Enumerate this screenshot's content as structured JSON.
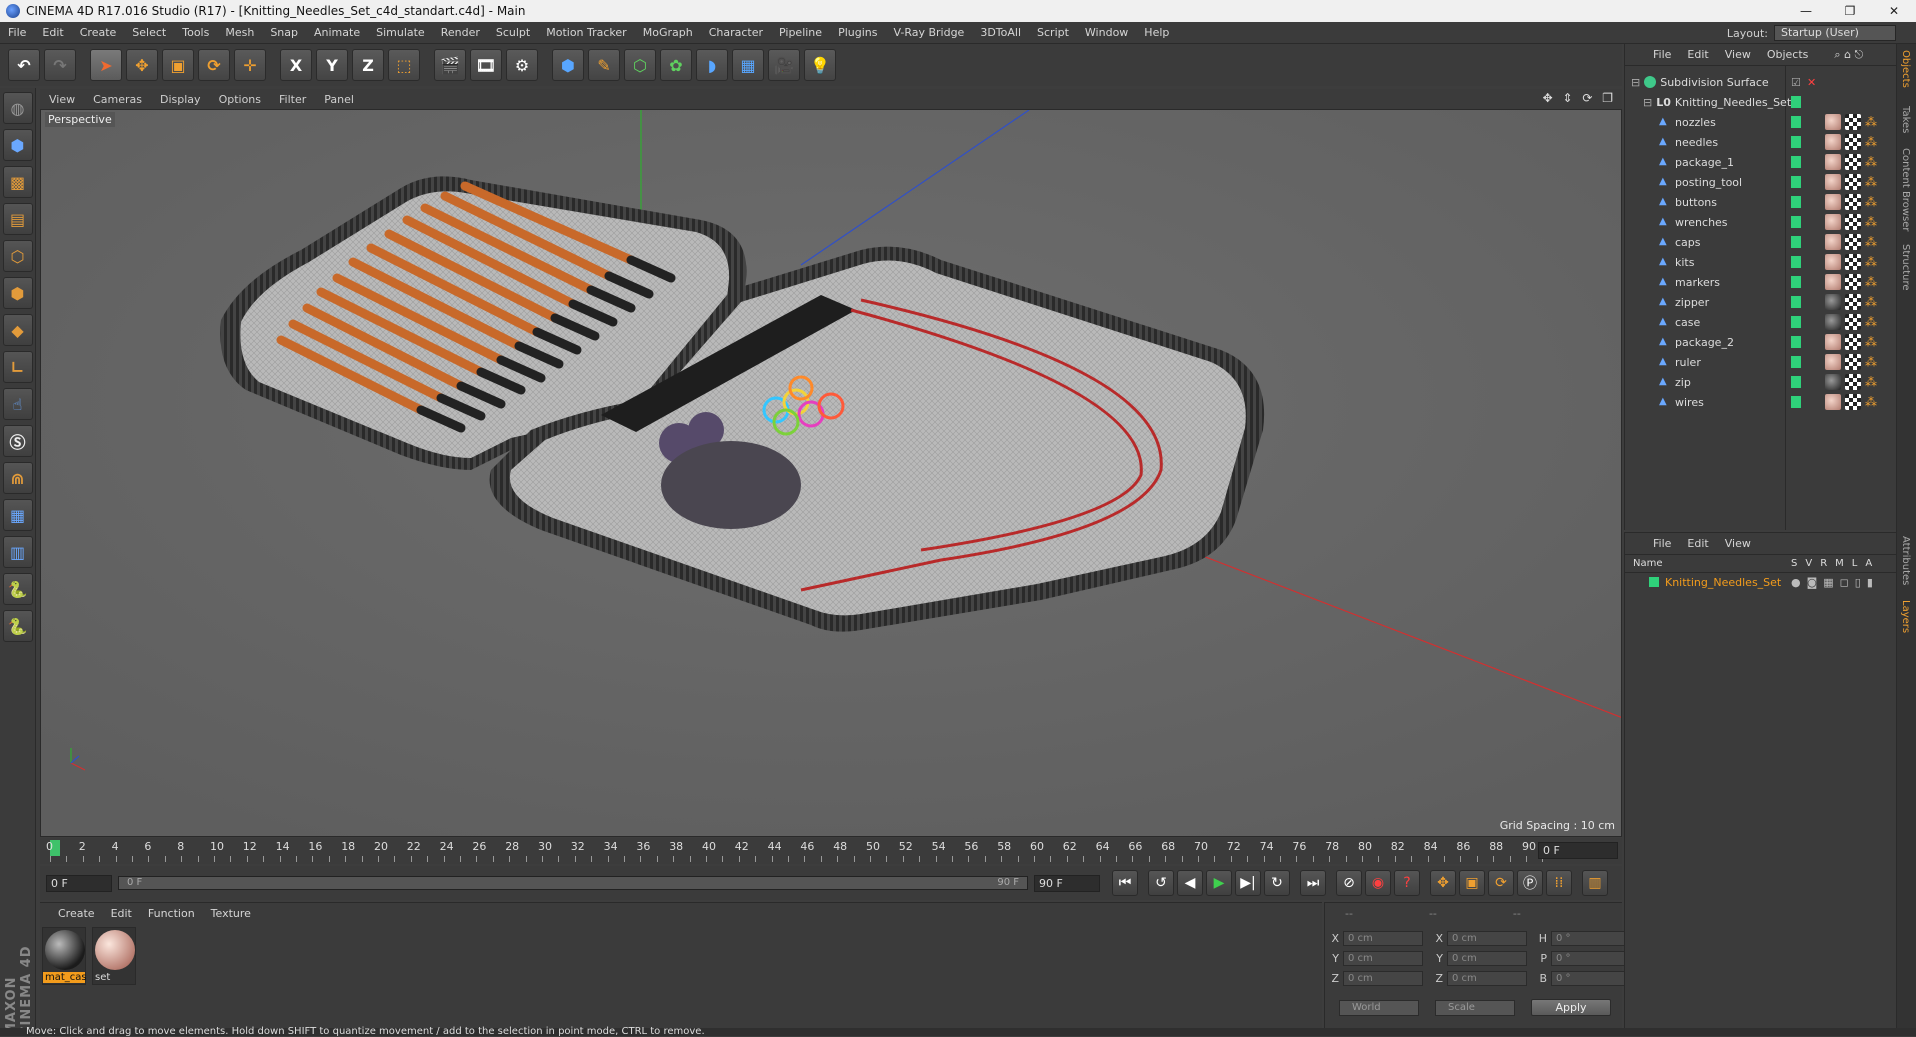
{
  "window": {
    "title": "CINEMA 4D R17.016 Studio (R17) - [Knitting_Needles_Set_c4d_standart.c4d] - Main",
    "controls": [
      "—",
      "❐",
      "✕"
    ]
  },
  "menubar": {
    "items": [
      "File",
      "Edit",
      "Create",
      "Select",
      "Tools",
      "Mesh",
      "Snap",
      "Animate",
      "Simulate",
      "Render",
      "Sculpt",
      "Motion Tracker",
      "MoGraph",
      "Character",
      "Pipeline",
      "Plugins",
      "V-Ray Bridge",
      "3DToAll",
      "Script",
      "Window",
      "Help"
    ],
    "layout_label": "Layout:",
    "layout_value": "Startup (User)"
  },
  "toolbar": {
    "undo": "↶",
    "redo": "↷",
    "axis": [
      "X",
      "Y",
      "Z"
    ]
  },
  "viewport": {
    "menu": [
      "View",
      "Cameras",
      "Display",
      "Options",
      "Filter",
      "Panel"
    ],
    "nav_icons": "✥ ⇕ ⟳ ❐",
    "camera_label": "Perspective",
    "grid_spacing": "Grid Spacing : 10 cm"
  },
  "timeline": {
    "ticks": [
      "0",
      "2",
      "4",
      "6",
      "8",
      "10",
      "12",
      "14",
      "16",
      "18",
      "20",
      "22",
      "24",
      "26",
      "28",
      "30",
      "32",
      "34",
      "36",
      "38",
      "40",
      "42",
      "44",
      "46",
      "48",
      "50",
      "52",
      "54",
      "56",
      "58",
      "60",
      "62",
      "64",
      "66",
      "68",
      "70",
      "72",
      "74",
      "76",
      "78",
      "80",
      "82",
      "84",
      "86",
      "88",
      "90"
    ],
    "current_frame": "0 F"
  },
  "transport": {
    "start_frame": "0 F",
    "range_start": "0 F",
    "range_end": "90 F",
    "end_frame": "90 F"
  },
  "material_manager": {
    "menu": [
      "Create",
      "Edit",
      "Function",
      "Texture"
    ],
    "materials": [
      {
        "name": "mat_cas",
        "selected": true
      },
      {
        "name": "set",
        "selected": false
      }
    ]
  },
  "coordinates": {
    "header": [
      "--",
      "--",
      "--"
    ],
    "rows": [
      {
        "a": "X",
        "av": "0 cm",
        "b": "X",
        "bv": "0 cm",
        "c": "H",
        "cv": "0 °"
      },
      {
        "a": "Y",
        "av": "0 cm",
        "b": "Y",
        "bv": "0 cm",
        "c": "P",
        "cv": "0 °"
      },
      {
        "a": "Z",
        "av": "0 cm",
        "b": "Z",
        "bv": "0 cm",
        "c": "B",
        "cv": "0 °"
      }
    ],
    "space": "World",
    "mode": "Scale",
    "apply": "Apply"
  },
  "object_manager": {
    "menu": [
      "File",
      "Edit",
      "View",
      "Objects"
    ],
    "root": "Subdivision Surface",
    "group": "Knitting_Needles_Set",
    "children": [
      {
        "name": "nozzles",
        "mat": "mat1"
      },
      {
        "name": "needles",
        "mat": "mat1"
      },
      {
        "name": "package_1",
        "mat": "mat1"
      },
      {
        "name": "posting_tool",
        "mat": "mat1"
      },
      {
        "name": "buttons",
        "mat": "mat1"
      },
      {
        "name": "wrenches",
        "mat": "mat1"
      },
      {
        "name": "caps",
        "mat": "mat1"
      },
      {
        "name": "kits",
        "mat": "mat1"
      },
      {
        "name": "markers",
        "mat": "mat1"
      },
      {
        "name": "zipper",
        "mat": "mat2"
      },
      {
        "name": "case",
        "mat": "mat2"
      },
      {
        "name": "package_2",
        "mat": "mat1"
      },
      {
        "name": "ruler",
        "mat": "mat1"
      },
      {
        "name": "zip",
        "mat": "mat2"
      },
      {
        "name": "wires",
        "mat": "mat1"
      }
    ]
  },
  "layer_manager": {
    "menu": [
      "File",
      "Edit",
      "View"
    ],
    "columns": [
      "Name",
      "S",
      "V",
      "R",
      "M",
      "L",
      "A"
    ],
    "layers": [
      "Knitting_Needles_Set"
    ]
  },
  "side_tabs": [
    "Objects",
    "Takes",
    "Content Browser",
    "Structure",
    "Attributes",
    "Layers"
  ],
  "brand": "MAXON CINEMA 4D",
  "status": "Move: Click and drag to move elements. Hold down SHIFT to quantize movement / add to the selection in point mode, CTRL to remove.",
  "colors": {
    "accent": "#f39c1c",
    "layer_green": "#2fd17a",
    "viewport_bg": "#686868",
    "axis_x": "#d23030",
    "axis_y": "#2fae2f",
    "axis_z": "#3050c8"
  }
}
